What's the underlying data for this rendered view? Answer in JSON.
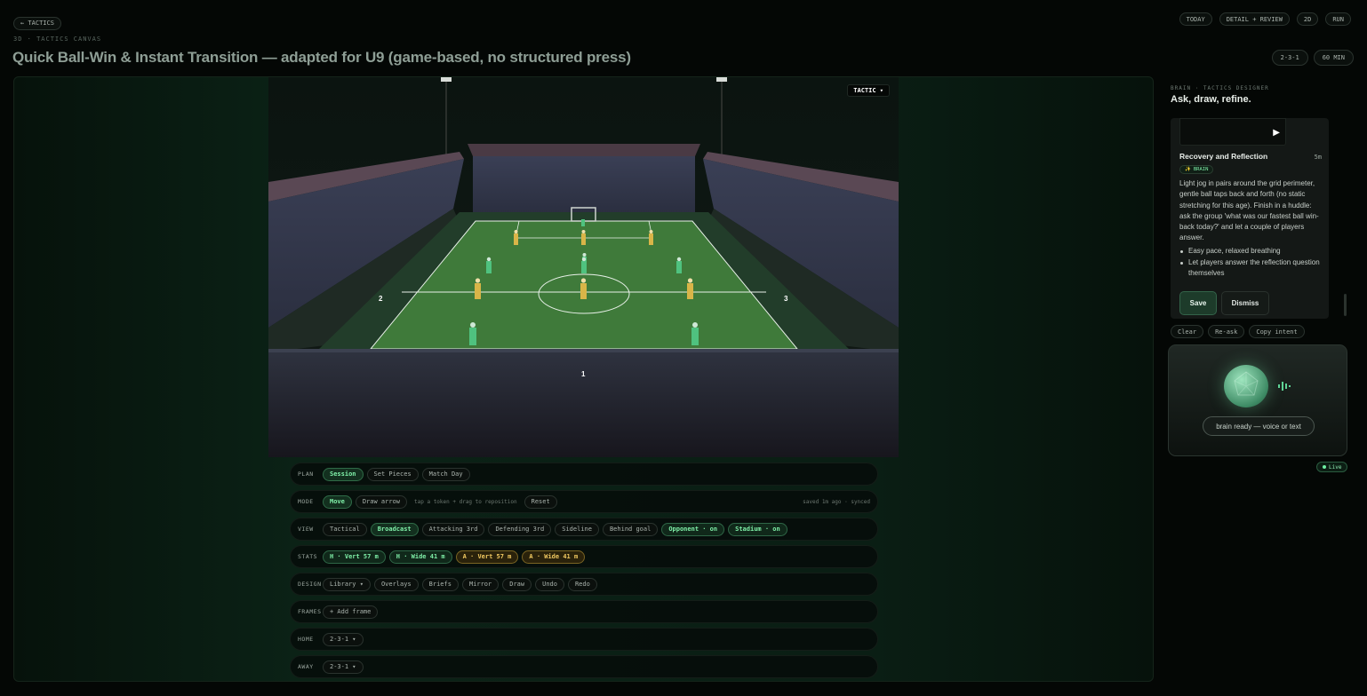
{
  "nav": {
    "back_label": "← TACTICS",
    "right_buttons": [
      "TODAY",
      "DETAIL + REVIEW",
      "2D",
      "RUN"
    ]
  },
  "header": {
    "eyebrow": "3D · TACTICS CANVAS",
    "title": "Quick Ball-Win & Instant Transition — adapted for U9 (game-based, no structured press)",
    "formation": "2-3-1",
    "duration": "60 MIN"
  },
  "stage": {
    "tactic_button": "TACTIC ▾",
    "zone_labels": [
      "1",
      "2",
      "3"
    ]
  },
  "toolbar": {
    "plan": {
      "label": "PLAN",
      "options": [
        "Session",
        "Set Pieces",
        "Match Day"
      ],
      "active": "Session"
    },
    "mode": {
      "label": "MODE",
      "options": [
        "Move",
        "Draw arrow"
      ],
      "active": "Move",
      "hint": "tap a token + drag to reposition",
      "reset": "Reset",
      "status": "saved 1m ago · synced"
    },
    "view": {
      "label": "VIEW",
      "options": [
        "Tactical",
        "Broadcast",
        "Attacking 3rd",
        "Defending 3rd",
        "Sideline",
        "Behind goal"
      ],
      "active": "Broadcast",
      "toggles": [
        "Opponent · on",
        "Stadium · on"
      ]
    },
    "stats": {
      "label": "STATS",
      "home": [
        "H · Vert 57 m",
        "H · Wide 41 m"
      ],
      "away": [
        "A · Vert 57 m",
        "A · Wide 41 m"
      ]
    },
    "design": {
      "label": "DESIGN",
      "options": [
        "Library ▾",
        "Overlays",
        "Briefs",
        "Mirror",
        "Draw",
        "Undo",
        "Redo"
      ]
    },
    "frames": {
      "label": "FRAMES",
      "add": "+ Add frame"
    },
    "home": {
      "label": "HOME",
      "value": "2-3-1 ▾"
    },
    "away": {
      "label": "AWAY",
      "value": "2-3-1 ▾"
    }
  },
  "brain": {
    "eyebrow": "BRAIN · TACTICS DESIGNER",
    "title": "Ask, draw, refine.",
    "card": {
      "title": "Recovery and Reflection",
      "duration": "5m",
      "badge": "BRAIN",
      "body": "Light jog in pairs around the grid perimeter, gentle ball taps back and forth (no static stretching for this age). Finish in a huddle: ask the group 'what was our fastest ball win-back today?' and let a couple of players answer.",
      "bullets": [
        "Easy pace, relaxed breathing",
        "Let players answer the reflection question themselves"
      ],
      "save": "Save",
      "dismiss": "Dismiss"
    },
    "actions": [
      "Clear",
      "Re-ask",
      "Copy intent"
    ],
    "voice_status": "brain ready — voice or text",
    "live": "Live"
  },
  "colors": {
    "accent": "#7ff0a8",
    "amber": "#f0c860",
    "pitch": "#3f7a3a",
    "home_team": "#4fc27f",
    "away_team": "#d9b548"
  }
}
